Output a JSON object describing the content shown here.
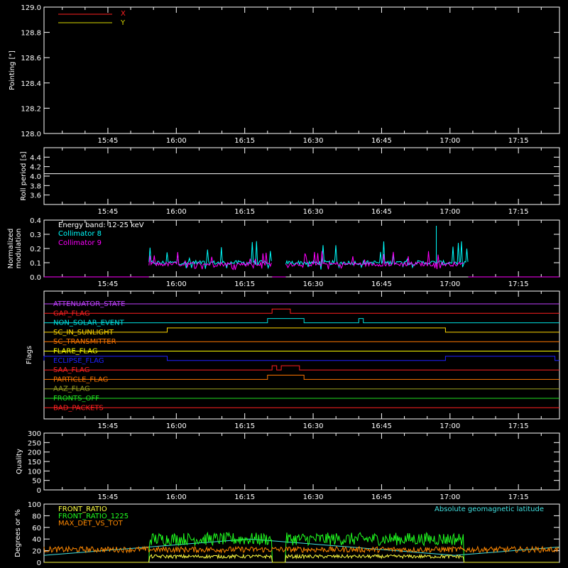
{
  "time_ticks": [
    "15:45",
    "16:00",
    "16:15",
    "16:30",
    "16:45",
    "17:00",
    "17:15"
  ],
  "colors": {
    "axis": "#ffffff",
    "x": "#ff2020",
    "y": "#d8d800",
    "c8": "#00ffff",
    "c9": "#ff00ff",
    "front_ratio": "#ffff40",
    "front_ratio_1225": "#20ff20",
    "max_det": "#ff8800",
    "geomag": "#40e0e0"
  },
  "chart_data": [
    {
      "type": "line",
      "ylabel": "Pointing [\"]",
      "ylim": [
        128.0,
        129.0
      ],
      "yticks": [
        "128.0",
        "128.2",
        "128.4",
        "128.6",
        "128.8",
        "129.0"
      ],
      "series": [
        {
          "name": "X",
          "values": []
        },
        {
          "name": "Y",
          "values": []
        }
      ]
    },
    {
      "type": "line",
      "ylabel": "Roll period [s]",
      "ylim": [
        3.4,
        4.6
      ],
      "yticks": [
        "3.6",
        "3.8",
        "4.0",
        "4.2",
        "4.4"
      ],
      "series": [
        {
          "values": [
            4.05
          ],
          "note_span": [
            "15:31",
            "17:23"
          ]
        }
      ]
    },
    {
      "type": "line",
      "ylabel": "Normalized modulation",
      "ylim": [
        0,
        0.4
      ],
      "yticks": [
        "0.0",
        "0.1",
        "0.2",
        "0.3",
        "0.4"
      ],
      "annotation": "Energy band: 12-25 keV",
      "series": [
        {
          "name": "Collimator 8",
          "active_spans": [
            [
              "15:54",
              "16:21"
            ],
            [
              "16:24",
              "17:04"
            ]
          ],
          "baseline": 0.1,
          "max": 0.36
        },
        {
          "name": "Collimator 9",
          "active_spans": [
            [
              "15:54",
              "16:21"
            ],
            [
              "16:24",
              "17:03"
            ]
          ],
          "baseline": 0.09,
          "max": 0.25
        }
      ]
    },
    {
      "type": "line",
      "ylabel": "Flags",
      "flags": [
        {
          "name": "ATTENUATOR_STATE",
          "color": "#c040ff",
          "on": []
        },
        {
          "name": "GAP_FLAG",
          "color": "#ff2020",
          "on": [
            [
              "16:21",
              "16:25"
            ]
          ]
        },
        {
          "name": "NON_SOLAR_EVENT",
          "color": "#00e0e0",
          "on": [
            [
              "16:20",
              "16:28"
            ],
            [
              "16:40",
              "16:41"
            ]
          ]
        },
        {
          "name": "SC_IN_SUNLIGHT",
          "color": "#ffd700",
          "on": [
            [
              "15:58",
              "16:59"
            ]
          ]
        },
        {
          "name": "SC_TRANSMITTER",
          "color": "#ff7700",
          "on": []
        },
        {
          "name": "FLARE_FLAG",
          "color": "#ffff00",
          "on": []
        },
        {
          "name": "ECLIPSE_FLAG",
          "color": "#2020ff",
          "on": [
            [
              "15:31",
              "15:58"
            ],
            [
              "16:59",
              "17:23"
            ]
          ]
        },
        {
          "name": "SAA_FLAG",
          "color": "#ff2020",
          "on": [
            [
              "16:21",
              "16:22"
            ],
            [
              "16:23",
              "16:27"
            ]
          ]
        },
        {
          "name": "PARTICLE_FLAG",
          "color": "#ff7700",
          "on": [
            [
              "16:20",
              "16:28"
            ]
          ]
        },
        {
          "name": "AAZ_FLAG",
          "color": "#9aa020",
          "on": []
        },
        {
          "name": "FRONTS_OFF",
          "color": "#20e020",
          "on": []
        },
        {
          "name": "BAD_PACKETS",
          "color": "#ff2020",
          "on": []
        }
      ]
    },
    {
      "type": "line",
      "ylabel": "Quality",
      "ylim": [
        0,
        300
      ],
      "yticks": [
        "0",
        "50",
        "100",
        "150",
        "200",
        "250",
        "300"
      ],
      "series": []
    },
    {
      "type": "line",
      "ylabel": "Degrees or %",
      "ylim": [
        0,
        100
      ],
      "yticks": [
        "0",
        "20",
        "40",
        "60",
        "80",
        "100"
      ],
      "legend_right": "Absolute geomagnetic latitude",
      "series": [
        {
          "name": "FRONT_RATIO",
          "approx_level": 10
        },
        {
          "name": "FRONT_RATIO_1225",
          "approx_level": 40
        },
        {
          "name": "MAX_DET_VS_TOT",
          "approx_level": 22
        }
      ]
    }
  ]
}
